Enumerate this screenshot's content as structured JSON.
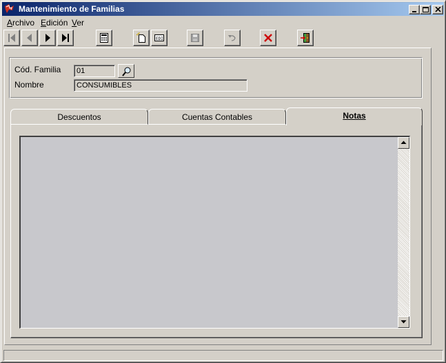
{
  "window": {
    "title": "Mantenimiento de Familias",
    "icon": "app-logo-icon"
  },
  "menu": {
    "items": [
      {
        "underline": "A",
        "rest": "rchivo"
      },
      {
        "underline": "E",
        "rest": "dición"
      },
      {
        "underline": "V",
        "rest": "er"
      }
    ]
  },
  "toolbar": {
    "icons": [
      "first-record-icon",
      "previous-record-icon",
      "next-record-icon",
      "last-record-icon",
      "calculator-icon",
      "new-record-icon",
      "edit-record-icon",
      "save-icon",
      "undo-icon",
      "delete-icon",
      "exit-icon"
    ]
  },
  "form": {
    "codigo_label": "Cód. Familia",
    "codigo_value": "01",
    "nombre_label": "Nombre",
    "nombre_value": "CONSUMIBLES"
  },
  "tabs": [
    {
      "label": "Descuentos",
      "active": false
    },
    {
      "label": "Cuentas Contables",
      "active": false
    },
    {
      "label": "Notas",
      "active": true
    }
  ],
  "notes": {
    "value": ""
  },
  "colors": {
    "titlebar_start": "#0a246a",
    "titlebar_end": "#a6caf0",
    "face": "#d4d0c8",
    "notes_bg": "#c8c8cc",
    "delete_red": "#cc0000"
  }
}
